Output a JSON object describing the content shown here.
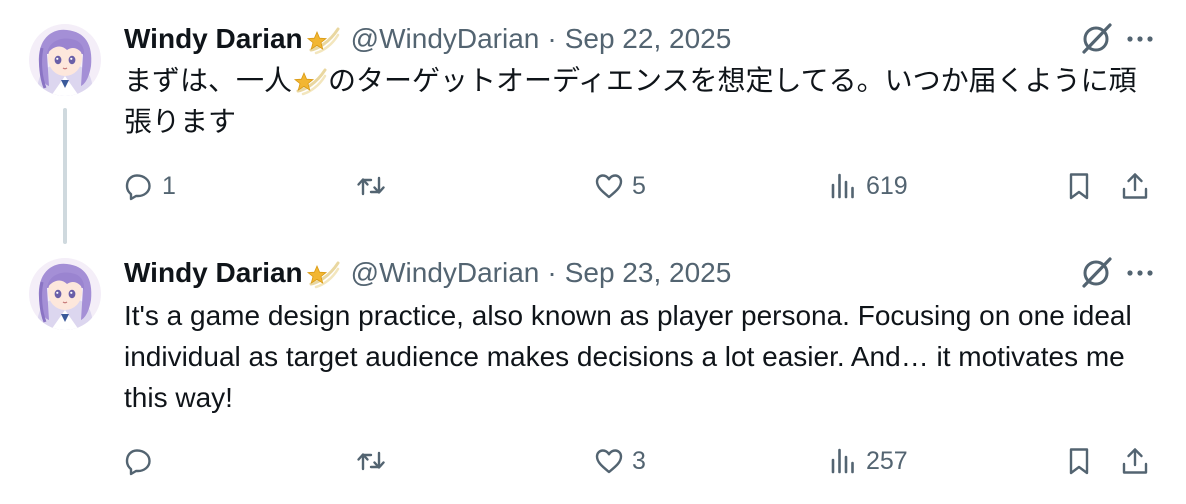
{
  "tweets": [
    {
      "author_name": "Windy Darian",
      "author_handle": "@WindyDarian",
      "separator": "·",
      "date": "Sep 22, 2025",
      "text_part1": "まずは、一人",
      "text_part2": "のターゲットオーディエンスを想定してる。いつか届くように頑張ります",
      "reply_count": "1",
      "retweet_count": "",
      "like_count": "5",
      "view_count": "619"
    },
    {
      "author_name": "Windy Darian",
      "author_handle": "@WindyDarian",
      "separator": "·",
      "date": "Sep 23, 2025",
      "text": "It's a game design practice, also known as player persona. Focusing on one ideal individual as target audience makes decisions a lot easier. And… it motivates me this way!",
      "reply_count": "",
      "retweet_count": "",
      "like_count": "3",
      "view_count": "257"
    }
  ],
  "icons": {
    "reply": "reply-icon",
    "retweet": "retweet-icon",
    "like": "heart-icon",
    "views": "views-icon",
    "bookmark": "bookmark-icon",
    "share": "share-icon",
    "grok": "grok-icon",
    "more": "more-icon",
    "emoji": "shooting-star-emoji"
  },
  "colors": {
    "text": "#0f1419",
    "secondary": "#536471",
    "thread_line": "#cfd9de",
    "avatar_hair": "#a48fd6",
    "emoji_star": "#f2b632"
  }
}
